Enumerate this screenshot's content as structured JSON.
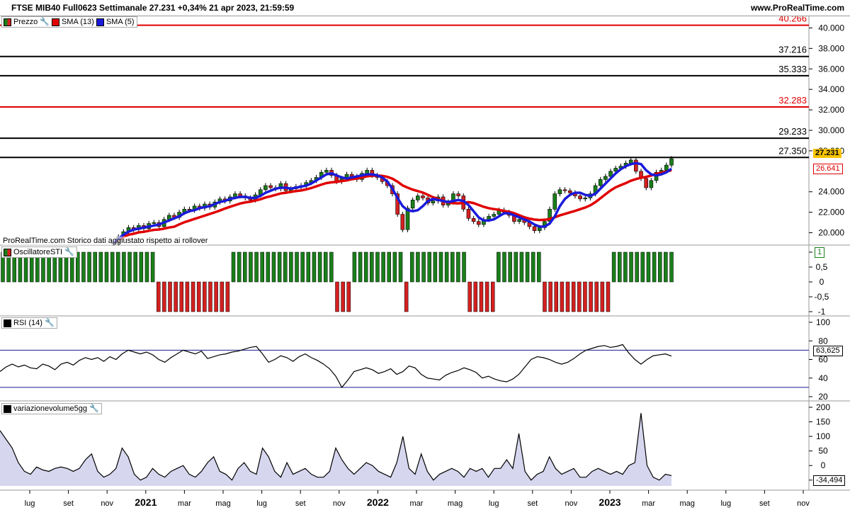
{
  "header": {
    "title": "FTSE MIB40 Full0623 Settimanale 27.231 +0,34% 21 apr 2023, 21:59:59",
    "site": "www.ProRealTime.com"
  },
  "legends": {
    "price": {
      "label_price": "Prezzo",
      "label_sma13": "SMA (13)",
      "label_sma5": "SMA (5)"
    },
    "sti": "OscillatoreSTI",
    "rsi": "RSI (14)",
    "vol": "variazionevolume5gg"
  },
  "watermark": "ProRealTime.com  Storico dati aggiustato rispetto ai rollover",
  "badges": {
    "last": "27.231",
    "sma13": "26.641",
    "sti": "1",
    "rsi": "63,625",
    "vol": "-34,494"
  },
  "colors": {
    "up": "#1a7f1a",
    "down": "#d42020",
    "sma13": "#e00000",
    "sma5": "#1a1adb",
    "badge_last": "#f5c400",
    "level_red": "#e00000",
    "level_black": "#000000"
  },
  "chart_data": [
    {
      "type": "candlestick",
      "title": "FTSE MIB40 Full0623 Settimanale",
      "ylim": [
        19000,
        41000
      ],
      "y_ticks": [
        "40.000",
        "38.000",
        "36.000",
        "34.000",
        "32.000",
        "30.000",
        "28.000",
        "24.000",
        "22.000",
        "20.000"
      ],
      "x_ticks": [
        "lug",
        "set",
        "nov",
        "2021",
        "mar",
        "mag",
        "lug",
        "set",
        "nov",
        "2022",
        "mar",
        "mag",
        "lug",
        "set",
        "nov",
        "2023",
        "mar",
        "mag",
        "lug",
        "set",
        "nov"
      ],
      "levels": [
        {
          "value": 40266,
          "label": "40.266",
          "color": "red"
        },
        {
          "value": 37216,
          "label": "37.216",
          "color": "black"
        },
        {
          "value": 35333,
          "label": "35.333",
          "color": "black"
        },
        {
          "value": 32283,
          "label": "32.283",
          "color": "red"
        },
        {
          "value": 29233,
          "label": "29.233",
          "color": "black"
        },
        {
          "value": 27350,
          "label": "27.350",
          "color": "black"
        }
      ],
      "close": [
        19000,
        19600,
        20100,
        20500,
        20300,
        20700,
        20400,
        20900,
        21000,
        20600,
        21300,
        21700,
        21500,
        22000,
        22300,
        22200,
        22600,
        22400,
        22800,
        22500,
        23000,
        23300,
        23100,
        23500,
        23800,
        23600,
        23400,
        23200,
        23700,
        24200,
        24600,
        24400,
        24300,
        24800,
        24100,
        24300,
        24500,
        24600,
        24900,
        25100,
        25400,
        25900,
        26100,
        25600,
        25000,
        25300,
        25700,
        25500,
        25200,
        25800,
        26100,
        25600,
        25400,
        25000,
        24600,
        23800,
        21800,
        20300,
        22400,
        23200,
        23600,
        23400,
        22900,
        23100,
        23500,
        22700,
        23000,
        23800,
        23600,
        22300,
        21400,
        21100,
        20800,
        21300,
        21600,
        21800,
        22200,
        22000,
        21700,
        21100,
        21300,
        21000,
        20600,
        20200,
        20500,
        21100,
        22300,
        23800,
        24200,
        24100,
        23900,
        23600,
        23300,
        23400,
        23800,
        24600,
        25200,
        25500,
        26000,
        26300,
        26500,
        26800,
        27100,
        26000,
        25300,
        24400,
        25100,
        25900,
        26100,
        26600,
        27231
      ],
      "sma5": [
        19000,
        19400,
        19800,
        20100,
        20300,
        20400,
        20500,
        20600,
        20700,
        20800,
        21000,
        21200,
        21400,
        21600,
        21900,
        22100,
        22200,
        22400,
        22500,
        22600,
        22800,
        23000,
        23100,
        23300,
        23400,
        23500,
        23500,
        23400,
        23400,
        23600,
        23900,
        24100,
        24300,
        24400,
        24400,
        24300,
        24400,
        24500,
        24600,
        24800,
        25100,
        25400,
        25700,
        25800,
        25600,
        25400,
        25300,
        25400,
        25500,
        25600,
        25700,
        25700,
        25600,
        25400,
        25000,
        24300,
        23400,
        22600,
        22200,
        22100,
        22200,
        22600,
        23100,
        23300,
        23200,
        23100,
        23000,
        23100,
        23200,
        23100,
        22700,
        22100,
        21500,
        21200,
        21200,
        21300,
        21600,
        21900,
        21900,
        21700,
        21500,
        21300,
        21100,
        20800,
        20600,
        20600,
        20900,
        21600,
        22600,
        23300,
        23700,
        23900,
        23900,
        23700,
        23600,
        23800,
        24300,
        24800,
        25300,
        25800,
        26200,
        26500,
        26700,
        26800,
        26700,
        26100,
        25700,
        25600,
        25700,
        25900,
        26250
      ]
    },
    {
      "type": "bar",
      "title": "OscillatoreSTI",
      "ylim": [
        -1,
        1
      ],
      "y_ticks": [
        "1",
        "0,5",
        "0",
        "-0,5",
        "-1"
      ],
      "values": [
        1,
        1,
        1,
        1,
        1,
        1,
        1,
        1,
        1,
        1,
        1,
        1,
        1,
        1,
        1,
        1,
        1,
        1,
        1,
        1,
        1,
        1,
        1,
        1,
        1,
        1,
        1,
        -1,
        -1,
        -1,
        -1,
        -1,
        -1,
        -1,
        -1,
        -1,
        -1,
        -1,
        -1,
        -1,
        1,
        1,
        1,
        1,
        1,
        1,
        1,
        1,
        1,
        1,
        1,
        1,
        1,
        1,
        1,
        1,
        1,
        1,
        -1,
        -1,
        -1,
        1,
        1,
        1,
        1,
        1,
        1,
        1,
        1,
        1,
        -1,
        1,
        1,
        1,
        1,
        1,
        1,
        1,
        1,
        1,
        1,
        -1,
        -1,
        -1,
        -1,
        -1,
        1,
        1,
        1,
        1,
        1,
        1,
        1,
        1,
        -1,
        -1,
        -1,
        -1,
        -1,
        -1,
        -1,
        -1,
        -1,
        -1,
        -1,
        -1,
        1,
        1,
        1,
        1,
        1,
        1,
        1,
        1,
        1,
        1,
        1
      ]
    },
    {
      "type": "line",
      "title": "RSI (14)",
      "ylim": [
        20,
        100
      ],
      "y_ticks": [
        "100",
        "80",
        "60",
        "40",
        "20"
      ],
      "bands": [
        70,
        30
      ],
      "values": [
        47,
        52,
        55,
        52,
        54,
        51,
        50,
        55,
        53,
        49,
        55,
        57,
        54,
        59,
        62,
        60,
        62,
        58,
        63,
        60,
        66,
        70,
        68,
        66,
        68,
        65,
        60,
        57,
        62,
        66,
        70,
        68,
        66,
        69,
        61,
        63,
        65,
        66,
        68,
        69,
        71,
        73,
        74,
        66,
        57,
        60,
        64,
        62,
        58,
        63,
        66,
        62,
        59,
        55,
        50,
        42,
        30,
        38,
        47,
        49,
        51,
        49,
        45,
        47,
        50,
        44,
        47,
        53,
        51,
        44,
        40,
        39,
        38,
        43,
        46,
        48,
        51,
        49,
        46,
        40,
        42,
        39,
        37,
        36,
        39,
        44,
        52,
        60,
        63,
        62,
        60,
        57,
        55,
        57,
        61,
        66,
        70,
        72,
        74,
        75,
        73,
        74,
        76,
        67,
        60,
        55,
        60,
        64,
        65,
        66,
        63.625
      ]
    },
    {
      "type": "area",
      "title": "variazionevolume5gg",
      "ylim": [
        -70,
        200
      ],
      "y_ticks": [
        "200",
        "150",
        "100",
        "50",
        "0",
        "-50"
      ],
      "values": [
        120,
        90,
        60,
        10,
        -20,
        -30,
        -5,
        -15,
        -20,
        -10,
        -5,
        -10,
        -20,
        -10,
        20,
        40,
        -20,
        -40,
        -30,
        -10,
        60,
        30,
        -30,
        -50,
        -40,
        -10,
        -30,
        -40,
        -20,
        -10,
        0,
        -30,
        -40,
        -20,
        10,
        30,
        -20,
        -30,
        -50,
        -10,
        10,
        -20,
        -30,
        60,
        30,
        -20,
        -40,
        10,
        -30,
        -20,
        -10,
        -30,
        -40,
        -40,
        -20,
        60,
        20,
        -10,
        -30,
        -10,
        10,
        0,
        -20,
        -30,
        -40,
        10,
        100,
        -10,
        -30,
        40,
        -20,
        -50,
        -30,
        -20,
        -10,
        -20,
        -40,
        -10,
        -20,
        -10,
        -40,
        -10,
        -10,
        20,
        -10,
        110,
        -20,
        -50,
        -30,
        -20,
        30,
        -10,
        -30,
        -20,
        -10,
        -40,
        -40,
        -20,
        -10,
        -20,
        -30,
        -20,
        -30,
        0,
        10,
        180,
        0,
        -40,
        -50,
        -30,
        -34.494
      ]
    }
  ]
}
